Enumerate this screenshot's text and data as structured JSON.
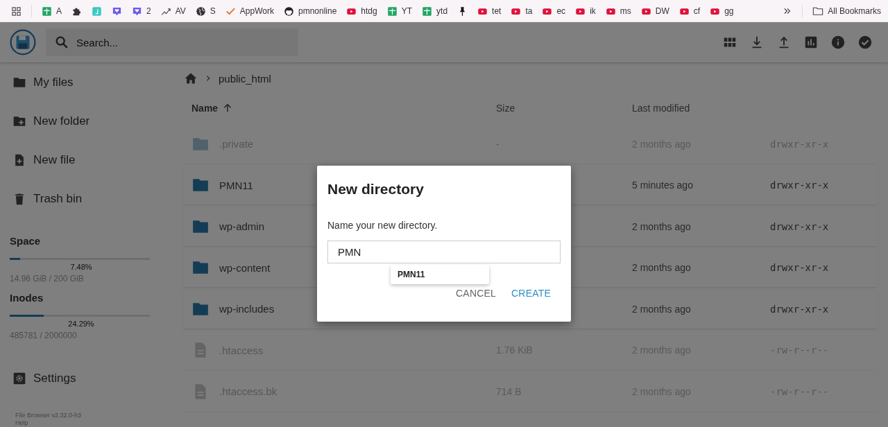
{
  "bookmarks_bar": {
    "items": [
      {
        "kind": "apps"
      },
      {
        "kind": "sheet",
        "label": "A"
      },
      {
        "kind": "puzzle"
      },
      {
        "kind": "square"
      },
      {
        "kind": "heart"
      },
      {
        "kind": "heart",
        "label": "2"
      },
      {
        "kind": "trend",
        "label": "AV"
      },
      {
        "kind": "globe",
        "label": "S"
      },
      {
        "kind": "check",
        "label": "AppWork"
      },
      {
        "kind": "github",
        "label": "pmnonline"
      },
      {
        "kind": "video",
        "label": "htdg"
      },
      {
        "kind": "sheet",
        "label": "YT"
      },
      {
        "kind": "sheet",
        "label": "ytd"
      },
      {
        "kind": "pin"
      },
      {
        "kind": "video",
        "label": "tet"
      },
      {
        "kind": "video",
        "label": "ta"
      },
      {
        "kind": "video",
        "label": "ec"
      },
      {
        "kind": "video",
        "label": "ik"
      },
      {
        "kind": "video",
        "label": "ms"
      },
      {
        "kind": "video",
        "label": "DW"
      },
      {
        "kind": "video",
        "label": "cf"
      },
      {
        "kind": "video",
        "label": "gg"
      }
    ],
    "all_bookmarks": "All Bookmarks"
  },
  "header": {
    "search": {
      "placeholder": "Search..."
    }
  },
  "sidebar": {
    "items": [
      {
        "kind": "folder",
        "label": "My files"
      },
      {
        "kind": "new-folder",
        "label": "New folder"
      },
      {
        "kind": "new-file",
        "label": "New file"
      },
      {
        "kind": "trash",
        "label": "Trash bin"
      }
    ],
    "usage": [
      {
        "title": "Space",
        "level": 0.0748,
        "percent": "7.48%",
        "detail": "14.96 GiB / 200 GiB"
      },
      {
        "title": "Inodes",
        "level": 0.2429,
        "percent": "24.29%",
        "detail": "485781 / 2000000"
      }
    ],
    "settings": "Settings",
    "footer": [
      "File Browser v2.32.0-h3",
      "Help"
    ]
  },
  "breadcrumb": [
    "public_html"
  ],
  "listing": {
    "columns": [
      {
        "label": "Name",
        "sorted": true
      },
      {
        "label": "Size",
        "sorted": false
      },
      {
        "label": "Last modified",
        "sorted": false
      }
    ],
    "rows": [
      {
        "kind": "folder",
        "hidden": true,
        "name": ".private",
        "size": "-",
        "modified": "2 months ago",
        "permissions": "drwxr-xr-x"
      },
      {
        "kind": "folder",
        "hidden": false,
        "name": "PMN11",
        "modified": "5 minutes ago",
        "permissions": "drwxr-xr-x"
      },
      {
        "kind": "folder",
        "hidden": false,
        "name": "wp-admin",
        "modified": "2 months ago",
        "permissions": "drwxr-xr-x"
      },
      {
        "kind": "folder",
        "hidden": false,
        "name": "wp-content",
        "modified": "2 months ago",
        "permissions": "drwxr-xr-x"
      },
      {
        "kind": "folder",
        "hidden": false,
        "name": "wp-includes",
        "modified": "2 months ago",
        "permissions": "drwxr-xr-x"
      },
      {
        "kind": "file",
        "hidden": true,
        "name": ".htaccess",
        "size": "1.76 KiB",
        "modified": "2 months ago",
        "permissions": "-rw-r--r--"
      },
      {
        "kind": "file",
        "hidden": true,
        "name": ".htaccess.bk",
        "size": "714 B",
        "modified": "2 months ago",
        "permissions": "-rw-r--r--"
      }
    ]
  },
  "dialog": {
    "title": "New directory",
    "prompt": "Name your new directory.",
    "input": {
      "value": "PMN"
    },
    "suggestions": [
      "PMN11"
    ],
    "buttons": [
      {
        "kind": "secondary",
        "label": "CANCEL"
      },
      {
        "kind": "primary",
        "label": "CREATE"
      }
    ]
  }
}
